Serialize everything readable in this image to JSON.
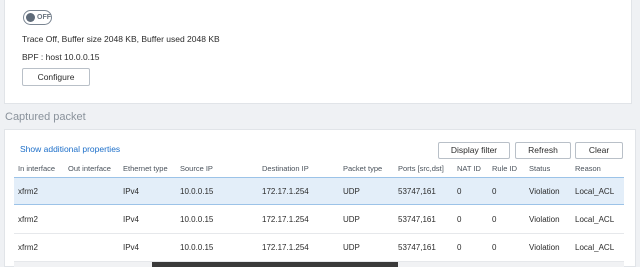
{
  "trace": {
    "toggle_label": "OFF",
    "status_text": "Trace Off, Buffer size 2048 KB, Buffer used 2048 KB",
    "bpf_text": "BPF : host 10.0.0.15",
    "configure_label": "Configure"
  },
  "captured": {
    "section_title": "Captured packet",
    "show_props_label": "Show additional properties",
    "display_filter_label": "Display filter",
    "refresh_label": "Refresh",
    "clear_label": "Clear",
    "columns": [
      "In interface",
      "Out interface",
      "Ethernet type",
      "Source IP",
      "Destination IP",
      "Packet type",
      "Ports [src,dst]",
      "NAT ID",
      "Rule ID",
      "Status",
      "Reason"
    ],
    "rows": [
      [
        "xfrm2",
        "",
        "IPv4",
        "10.0.0.15",
        "172.17.1.254",
        "UDP",
        "53747,161",
        "0",
        "0",
        "Violation",
        "Local_ACL"
      ],
      [
        "xfrm2",
        "",
        "IPv4",
        "10.0.0.15",
        "172.17.1.254",
        "UDP",
        "53747,161",
        "0",
        "0",
        "Violation",
        "Local_ACL"
      ],
      [
        "xfrm2",
        "",
        "IPv4",
        "10.0.0.15",
        "172.17.1.254",
        "UDP",
        "53747,161",
        "0",
        "0",
        "Violation",
        "Local_ACL"
      ]
    ]
  },
  "colors": {
    "accent": "#1d6fc9",
    "selected_row": "#e3eef9"
  }
}
